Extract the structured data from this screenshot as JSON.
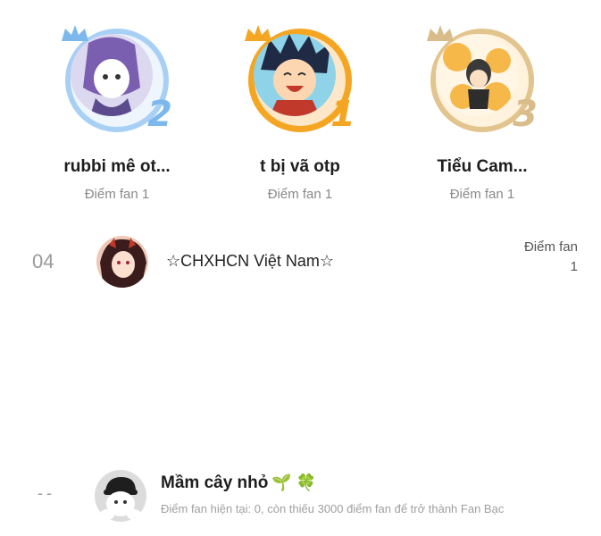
{
  "podium": [
    {
      "rank": "2",
      "name": "rubbi mê ot...",
      "score": "Điểm fan 1",
      "ring_color": "#a8d0f5"
    },
    {
      "rank": "1",
      "name": "t bị vã otp",
      "score": "Điểm fan 1",
      "ring_color": "#f4a623"
    },
    {
      "rank": "3",
      "name": "Tiểu Cam...",
      "score": "Điểm fan 1",
      "ring_color": "#e2c48e"
    }
  ],
  "list": [
    {
      "rank": "04",
      "name": "☆CHXHCN Việt Nam☆",
      "score_label": "Điểm fan",
      "score_value": "1"
    }
  ],
  "me": {
    "rank": "--",
    "name": "Mầm cây nhỏ",
    "emoji": "🌱 🍀",
    "progress_text": "Điểm fan hiện tại: 0, còn thiếu 3000 điểm fan để trở thành Fan Bạc"
  }
}
